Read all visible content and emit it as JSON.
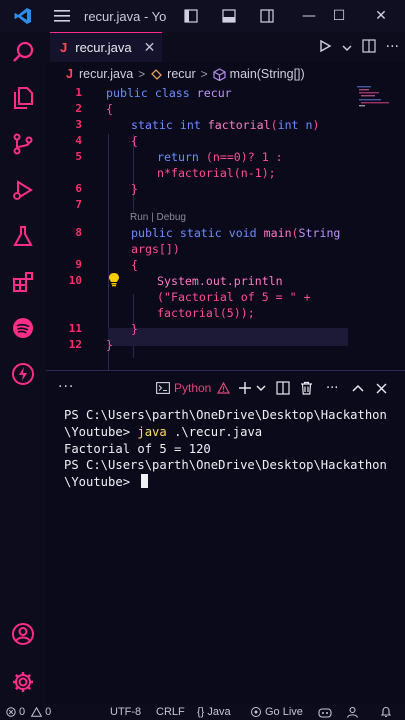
{
  "window": {
    "title": "recur.java - Yo",
    "minimize": "—",
    "maximize": "☐",
    "close": "✕"
  },
  "tabs": [
    {
      "icon": "J",
      "label": "recur.java",
      "close": "✕"
    }
  ],
  "breadcrumb": {
    "file_icon": "J",
    "file": "recur.java",
    "class": "recur",
    "method": "main(String[])"
  },
  "code": {
    "codelens": "Run | Debug",
    "lines": [
      {
        "n": "1"
      },
      {
        "n": "2"
      },
      {
        "n": "3"
      },
      {
        "n": "4"
      },
      {
        "n": "5"
      },
      {
        "n": ""
      },
      {
        "n": "6"
      },
      {
        "n": "7"
      },
      {
        "n": "8"
      },
      {
        "n": ""
      },
      {
        "n": "9"
      },
      {
        "n": "10"
      },
      {
        "n": ""
      },
      {
        "n": ""
      },
      {
        "n": "11"
      },
      {
        "n": "12"
      }
    ],
    "t1a": "public class ",
    "t1b": "recur",
    "t2": "{",
    "t3a": "static int ",
    "t3b": "factorial",
    "t3c": "(",
    "t3d": "int n",
    "t3e": ")",
    "t4": "{",
    "t5a": "return ",
    "t5b": "(n==0)? 1 :",
    "t5c": "n*factorial(n-1);",
    "t6": "}",
    "t8a": "public static void ",
    "t8b": "main",
    "t8c": "(",
    "t8d": "String",
    "t8e": "args[])",
    "t9": "{",
    "t10a": "System.out.println",
    "t10b": "(\"Factorial of 5 = \" +",
    "t10c": "factorial(5));",
    "t11": "}",
    "t12": "}"
  },
  "panel": {
    "dots": "···",
    "terminal_name": "Python",
    "terminal_lines": {
      "l1": "PS C:\\Users\\parth\\OneDrive\\Desktop\\Hackathon",
      "l2a": "\\Youtube> ",
      "l2b": "java",
      "l2c": " .\\recur.java",
      "l3": "Factorial of 5 = 120",
      "l4": "PS C:\\Users\\parth\\OneDrive\\Desktop\\Hackathon",
      "l5": "\\Youtube> "
    }
  },
  "status": {
    "errors": "0",
    "warnings": "0",
    "encoding": "UTF-8",
    "eol": "CRLF",
    "language": "{} Java",
    "golive": "Go Live"
  },
  "colors": {
    "accent": "#ff2e88",
    "line_numbers": "#ff2e6a",
    "background": "#0b0a1a"
  }
}
